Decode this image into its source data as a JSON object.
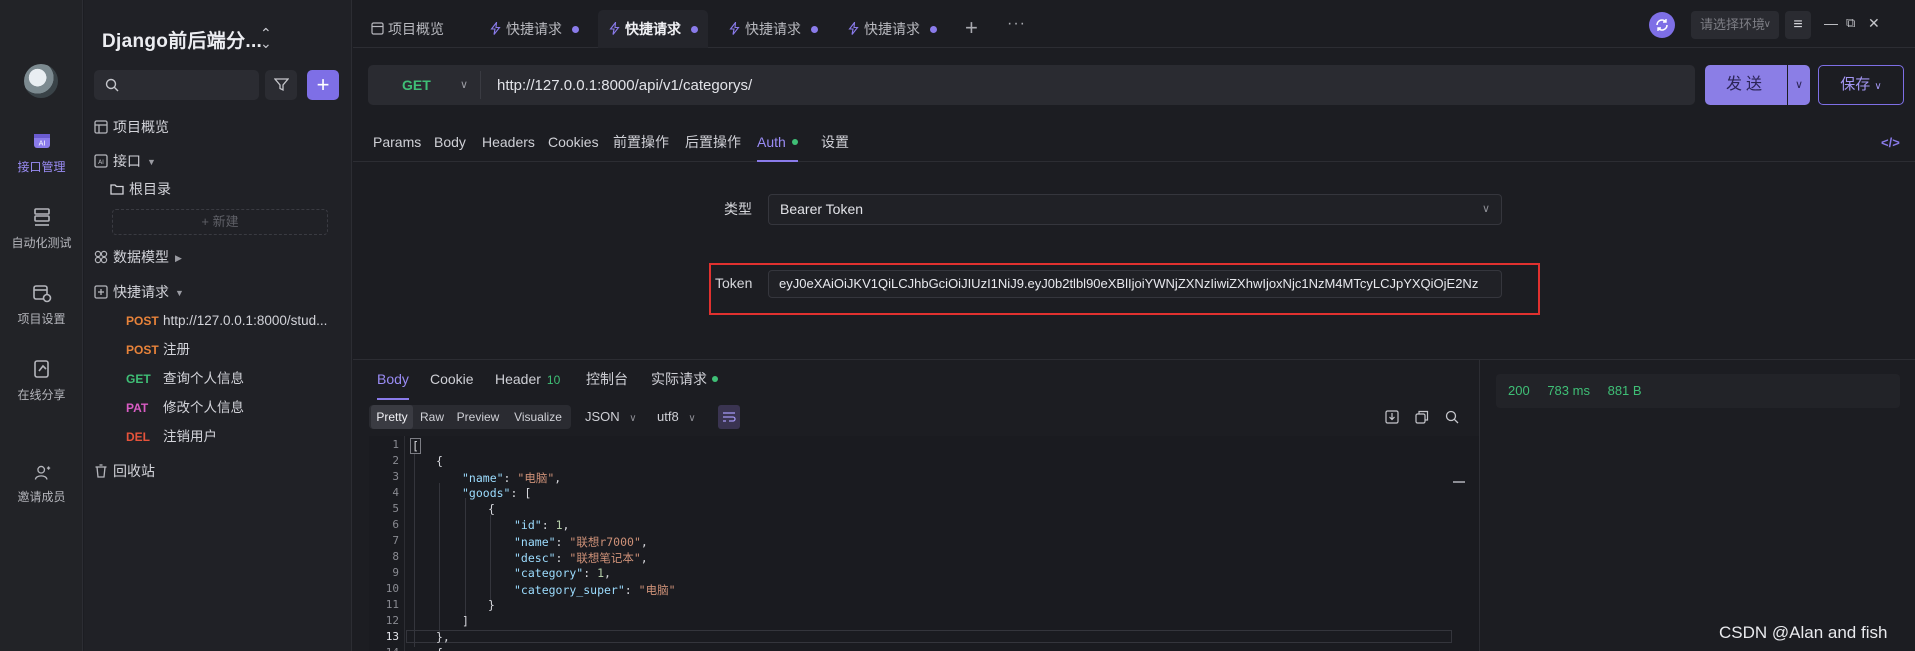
{
  "project": {
    "title": "Django前后端分..."
  },
  "rail": [
    {
      "label": "接口管理",
      "icon": "api-icon"
    },
    {
      "label": "自动化测试",
      "icon": "automation-icon"
    },
    {
      "label": "项目设置",
      "icon": "settings-icon"
    },
    {
      "label": "在线分享",
      "icon": "share-icon"
    },
    {
      "label": "邀请成员",
      "icon": "invite-icon"
    }
  ],
  "sidebar": {
    "overview": "项目概览",
    "api": "接口",
    "root": "根目录",
    "new": "+ 新建",
    "models": "数据模型",
    "quick": "快捷请求",
    "requests": [
      {
        "method": "POST",
        "name": "http://127.0.0.1:8000/stud..."
      },
      {
        "method": "POST",
        "name": "注册"
      },
      {
        "method": "GET",
        "name": "查询个人信息"
      },
      {
        "method": "PAT",
        "name": "修改个人信息"
      },
      {
        "method": "DEL",
        "name": "注销用户"
      }
    ],
    "trash": "回收站"
  },
  "tabs": [
    {
      "label": "项目概览"
    },
    {
      "label": "快捷请求"
    },
    {
      "label": "快捷请求"
    },
    {
      "label": "快捷请求"
    },
    {
      "label": "快捷请求"
    }
  ],
  "topbar": {
    "env_placeholder": "请选择环境",
    "plus": "+",
    "more": "···",
    "menu": "≡"
  },
  "request": {
    "method": "GET",
    "url": "http://127.0.0.1:8000/api/v1/categorys/",
    "send": "发送",
    "save": "保存"
  },
  "subtabs": [
    "Params",
    "Body",
    "Headers",
    "Cookies",
    "前置操作",
    "后置操作",
    "Auth",
    "设置"
  ],
  "auth": {
    "type_label": "类型",
    "type_value": "Bearer Token",
    "token_label": "Token",
    "token_value": "eyJ0eXAiOiJKV1QiLCJhbGciOiJIUzI1NiJ9.eyJ0b2tlbl90eXBlIjoiYWNjZXNzIiwiZXhwIjoxNjc1NzM4MTcyLCJpYXQiOjE2Nz"
  },
  "response": {
    "tabs": [
      "Body",
      "Cookie",
      "Header",
      "控制台",
      "实际请求"
    ],
    "header_count": "10",
    "views": [
      "Pretty",
      "Raw",
      "Preview",
      "Visualize"
    ],
    "format": "JSON",
    "encoding": "utf8",
    "status": "200",
    "time": "783 ms",
    "size": "881 B",
    "lines": [
      "1",
      "2",
      "3",
      "4",
      "5",
      "6",
      "7",
      "8",
      "9",
      "10",
      "11",
      "12",
      "13",
      "14"
    ],
    "code": {
      "l1": "[",
      "l2": "{",
      "name_key": "\"name\"",
      "name_val": "\"电脑\"",
      "goods_key": "\"goods\"",
      "l4_tail": ": [",
      "l6": "{",
      "id_key": "\"id\"",
      "id_val": "1",
      "gname_key": "\"name\"",
      "gname_val": "\"联想r7000\"",
      "desc_key": "\"desc\"",
      "desc_val": "\"联想笔记本\"",
      "cat_key": "\"category\"",
      "cat_val": "1",
      "sup_key": "\"category_super\"",
      "sup_val": "\"电脑\"",
      "l11": "}",
      "l12": "]",
      "l13": "},",
      "l14": "{"
    }
  },
  "watermark": "CSDN @Alan and fish"
}
